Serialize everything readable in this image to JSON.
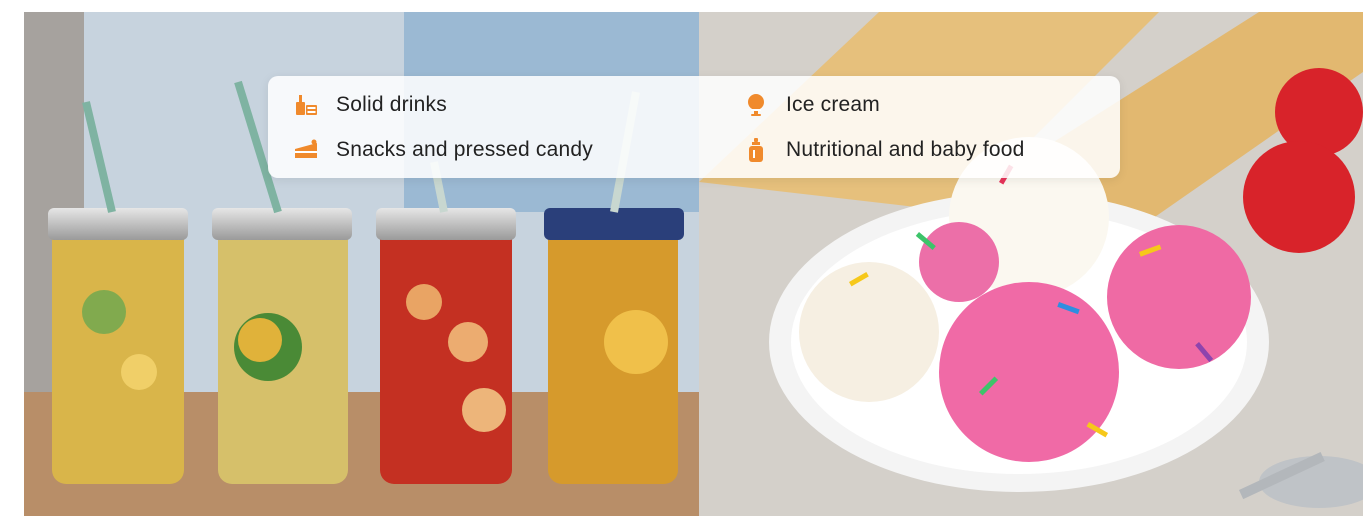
{
  "categories": [
    {
      "label": "Solid drinks",
      "icon": "drink-icon"
    },
    {
      "label": "Snacks and pressed candy",
      "icon": "cake-slice-icon"
    },
    {
      "label": "Ice cream",
      "icon": "ice-cream-icon"
    },
    {
      "label": "Nutritional and baby food",
      "icon": "baby-bottle-icon"
    }
  ],
  "colors": {
    "accent": "#f08a2c",
    "text": "#222222"
  },
  "images": {
    "left": "iced-tea-jars-photo",
    "right": "ice-cream-scoops-photo"
  }
}
